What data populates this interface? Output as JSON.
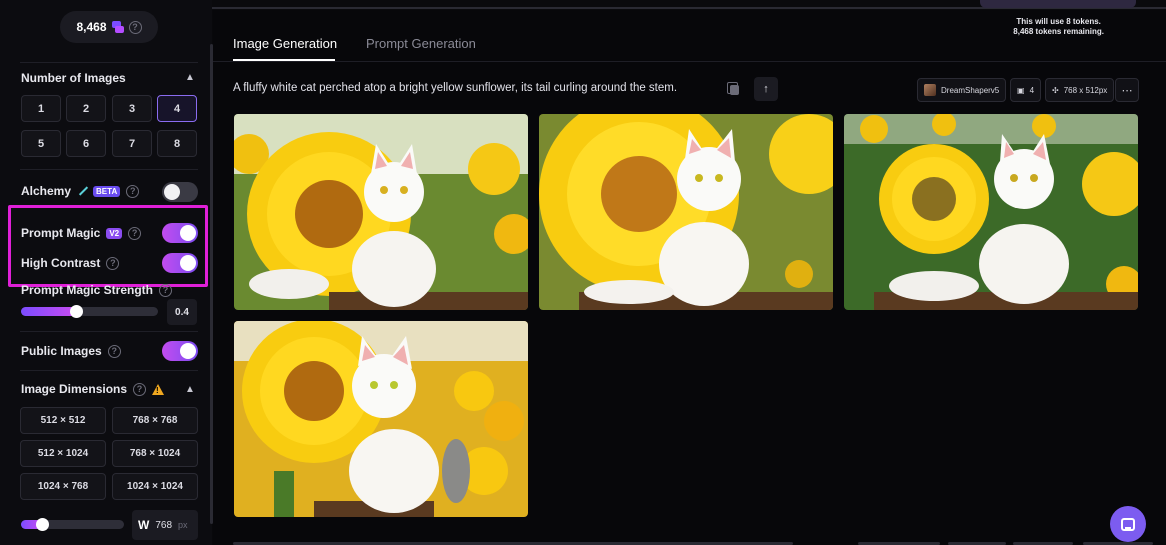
{
  "sidebar": {
    "token_balance": "8,468",
    "number_of_images": {
      "title": "Number of Images",
      "options": [
        "1",
        "2",
        "3",
        "4",
        "5",
        "6",
        "7",
        "8"
      ],
      "selected": "4"
    },
    "alchemy": {
      "label": "Alchemy",
      "badge": "BETA",
      "enabled": false
    },
    "prompt_magic": {
      "label": "Prompt Magic",
      "badge": "V2",
      "enabled": true
    },
    "high_contrast": {
      "label": "High Contrast",
      "enabled": true
    },
    "prompt_magic_strength": {
      "label": "Prompt Magic Strength",
      "value": "0.4",
      "fraction": 0.4
    },
    "public_images": {
      "label": "Public Images",
      "enabled": true
    },
    "image_dimensions": {
      "title": "Image Dimensions",
      "options": [
        "512 × 512",
        "768 × 768",
        "512 × 1024",
        "768 × 1024",
        "1024 × 768",
        "1024 × 1024"
      ]
    },
    "width": {
      "label": "W",
      "value": "768",
      "unit": "px",
      "fraction": 0.2
    }
  },
  "header": {
    "token_info_line1": "This will use 8 tokens.",
    "token_info_line2": "8,468 tokens remaining."
  },
  "tabs": [
    {
      "label": "Image Generation",
      "active": true
    },
    {
      "label": "Prompt Generation",
      "active": false
    }
  ],
  "generation": {
    "prompt": "A fluffy white cat perched atop a bright yellow sunflower, its tail curling around the stem.",
    "model": "DreamShaperv5",
    "image_count": "4",
    "dimensions": "768 x 512px",
    "more_icon": "ellipsis-icon",
    "upload_icon": "arrow-up-icon",
    "copy_icon": "copy-icon"
  },
  "colors": {
    "accent": "#7c4cf0",
    "toggle_gradient_start": "#c34cf0",
    "highlight": "#e020d8",
    "warning": "#f0a820"
  }
}
